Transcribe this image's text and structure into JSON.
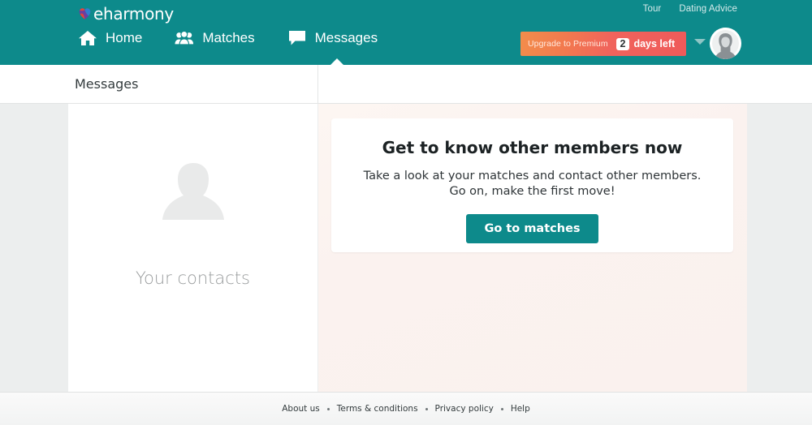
{
  "colors": {
    "teal": "#0d8a8b",
    "banner_start": "#f28d4b",
    "banner_end": "#ef5a5a",
    "page_bg": "#eceeee",
    "content_bg": "#fbf2ef"
  },
  "topbar": {
    "logo": {
      "text": "eharmony",
      "icon": "eharmony-heart-icon"
    },
    "util_links": [
      {
        "label": "Tour",
        "name": "tour-link"
      },
      {
        "label": "Dating Advice",
        "name": "dating-advice-link"
      }
    ],
    "nav": [
      {
        "label": "Home",
        "icon": "home-icon",
        "active": false
      },
      {
        "label": "Matches",
        "icon": "people-group-icon",
        "active": false
      },
      {
        "label": "Messages",
        "icon": "chat-bubble-icon",
        "active": true
      }
    ],
    "premium": {
      "label": "Upgrade to Premium",
      "days_number": "2",
      "days_label": "days left"
    },
    "account": {
      "caret_icon": "chevron-down-icon",
      "avatar_icon": "user-avatar-icon"
    }
  },
  "subheader": {
    "title": "Messages"
  },
  "contacts": {
    "placeholder_icon": "person-silhouette-icon",
    "label": "Your contacts"
  },
  "promo": {
    "title": "Get to know other members now",
    "line1": "Take a look at your matches and contact other members.",
    "line2": "Go on, make the first move!",
    "button": "Go to matches"
  },
  "footer": {
    "links": [
      {
        "label": "About us"
      },
      {
        "label": "Terms & conditions"
      },
      {
        "label": "Privacy policy"
      },
      {
        "label": "Help"
      }
    ]
  }
}
